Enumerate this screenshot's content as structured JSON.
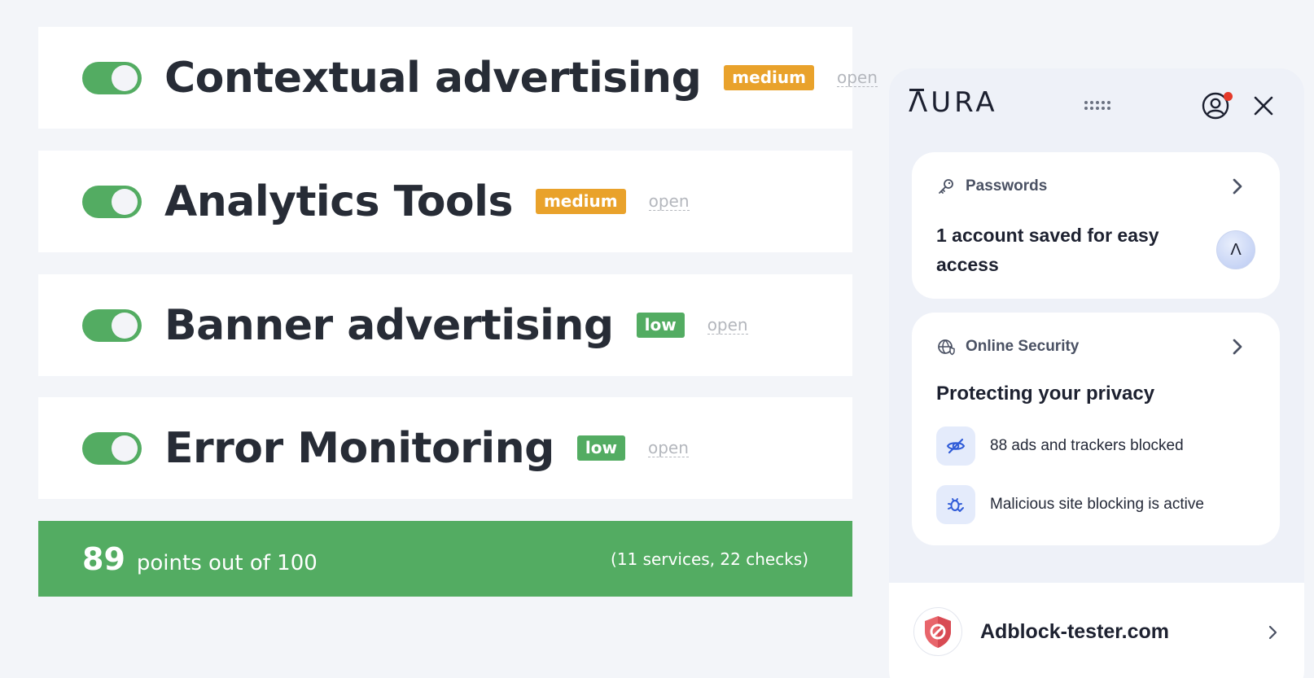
{
  "services": [
    {
      "name": "Contextual advertising",
      "level": "medium",
      "open_label": "open",
      "enabled": true
    },
    {
      "name": "Analytics Tools",
      "level": "medium",
      "open_label": "open",
      "enabled": true
    },
    {
      "name": "Banner advertising",
      "level": "low",
      "open_label": "open",
      "enabled": true
    },
    {
      "name": "Error Monitoring",
      "level": "low",
      "open_label": "open",
      "enabled": true
    }
  ],
  "score": {
    "points": "89",
    "suffix": "points out of 100",
    "details": "(11 services, 22 checks)"
  },
  "colors": {
    "toggle_on": "#53ac62",
    "badge_medium": "#e9a22b",
    "badge_low": "#53ac62",
    "score_bar": "#53ac62",
    "notification_dot": "#e53a2a"
  },
  "aura": {
    "logo": "ΛURA",
    "icons": [
      "grid-dots-icon",
      "profile-icon",
      "close-icon"
    ],
    "passwords": {
      "label": "Passwords",
      "text": "1 account saved for easy access",
      "avatar_glyph": "Λ"
    },
    "security": {
      "label": "Online Security",
      "title": "Protecting your privacy",
      "items": [
        {
          "text": "88 ads and trackers blocked",
          "icon": "eye-off-icon"
        },
        {
          "text": "Malicious site blocking is active",
          "icon": "bug-shield-icon"
        }
      ]
    },
    "site": {
      "name": "Adblock-tester.com",
      "icon": "blocked-shield-icon"
    }
  }
}
